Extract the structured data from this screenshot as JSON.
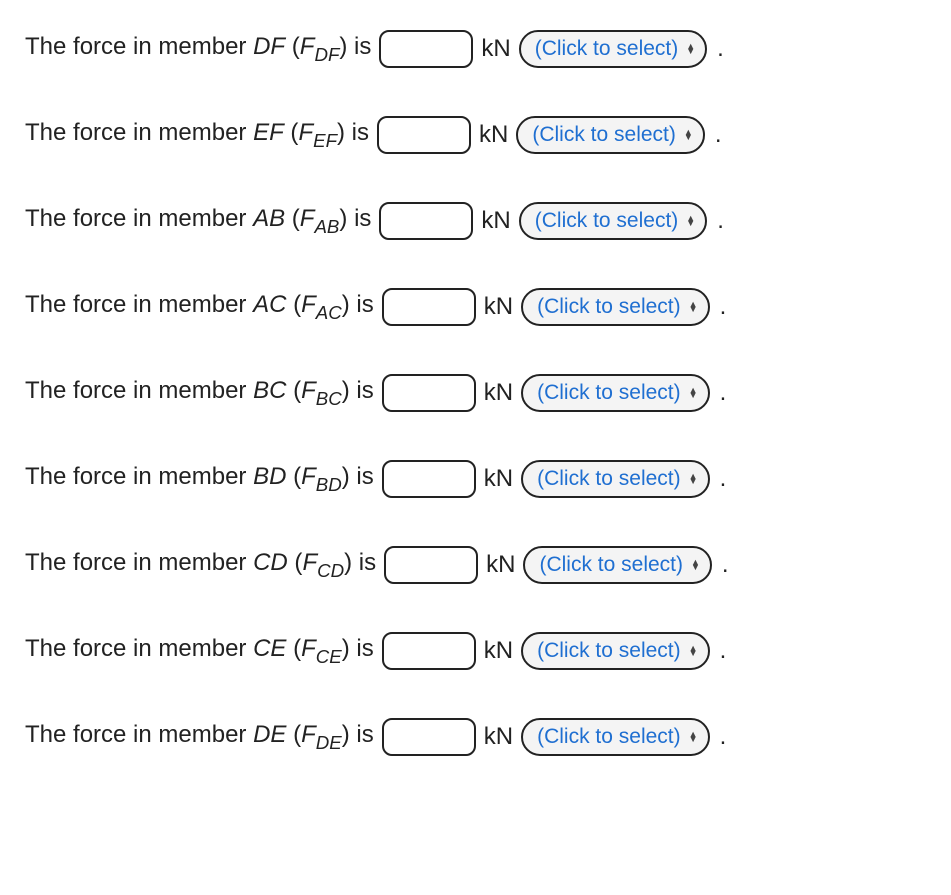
{
  "common": {
    "prefix": "The force in member ",
    "is": " is ",
    "unit": "kN",
    "selectPlaceholder": "(Click to select)",
    "period": "."
  },
  "rows": [
    {
      "member": "DF",
      "symbol_letter": "F",
      "symbol_sub": "DF"
    },
    {
      "member": "EF",
      "symbol_letter": "F",
      "symbol_sub": "EF"
    },
    {
      "member": "AB",
      "symbol_letter": "F",
      "symbol_sub": "AB"
    },
    {
      "member": "AC",
      "symbol_letter": "F",
      "symbol_sub": "AC"
    },
    {
      "member": "BC",
      "symbol_letter": "F",
      "symbol_sub": "BC"
    },
    {
      "member": "BD",
      "symbol_letter": "F",
      "symbol_sub": "BD"
    },
    {
      "member": "CD",
      "symbol_letter": "F",
      "symbol_sub": "CD"
    },
    {
      "member": "CE",
      "symbol_letter": "F",
      "symbol_sub": "CE"
    },
    {
      "member": "DE",
      "symbol_letter": "F",
      "symbol_sub": "DE"
    }
  ]
}
